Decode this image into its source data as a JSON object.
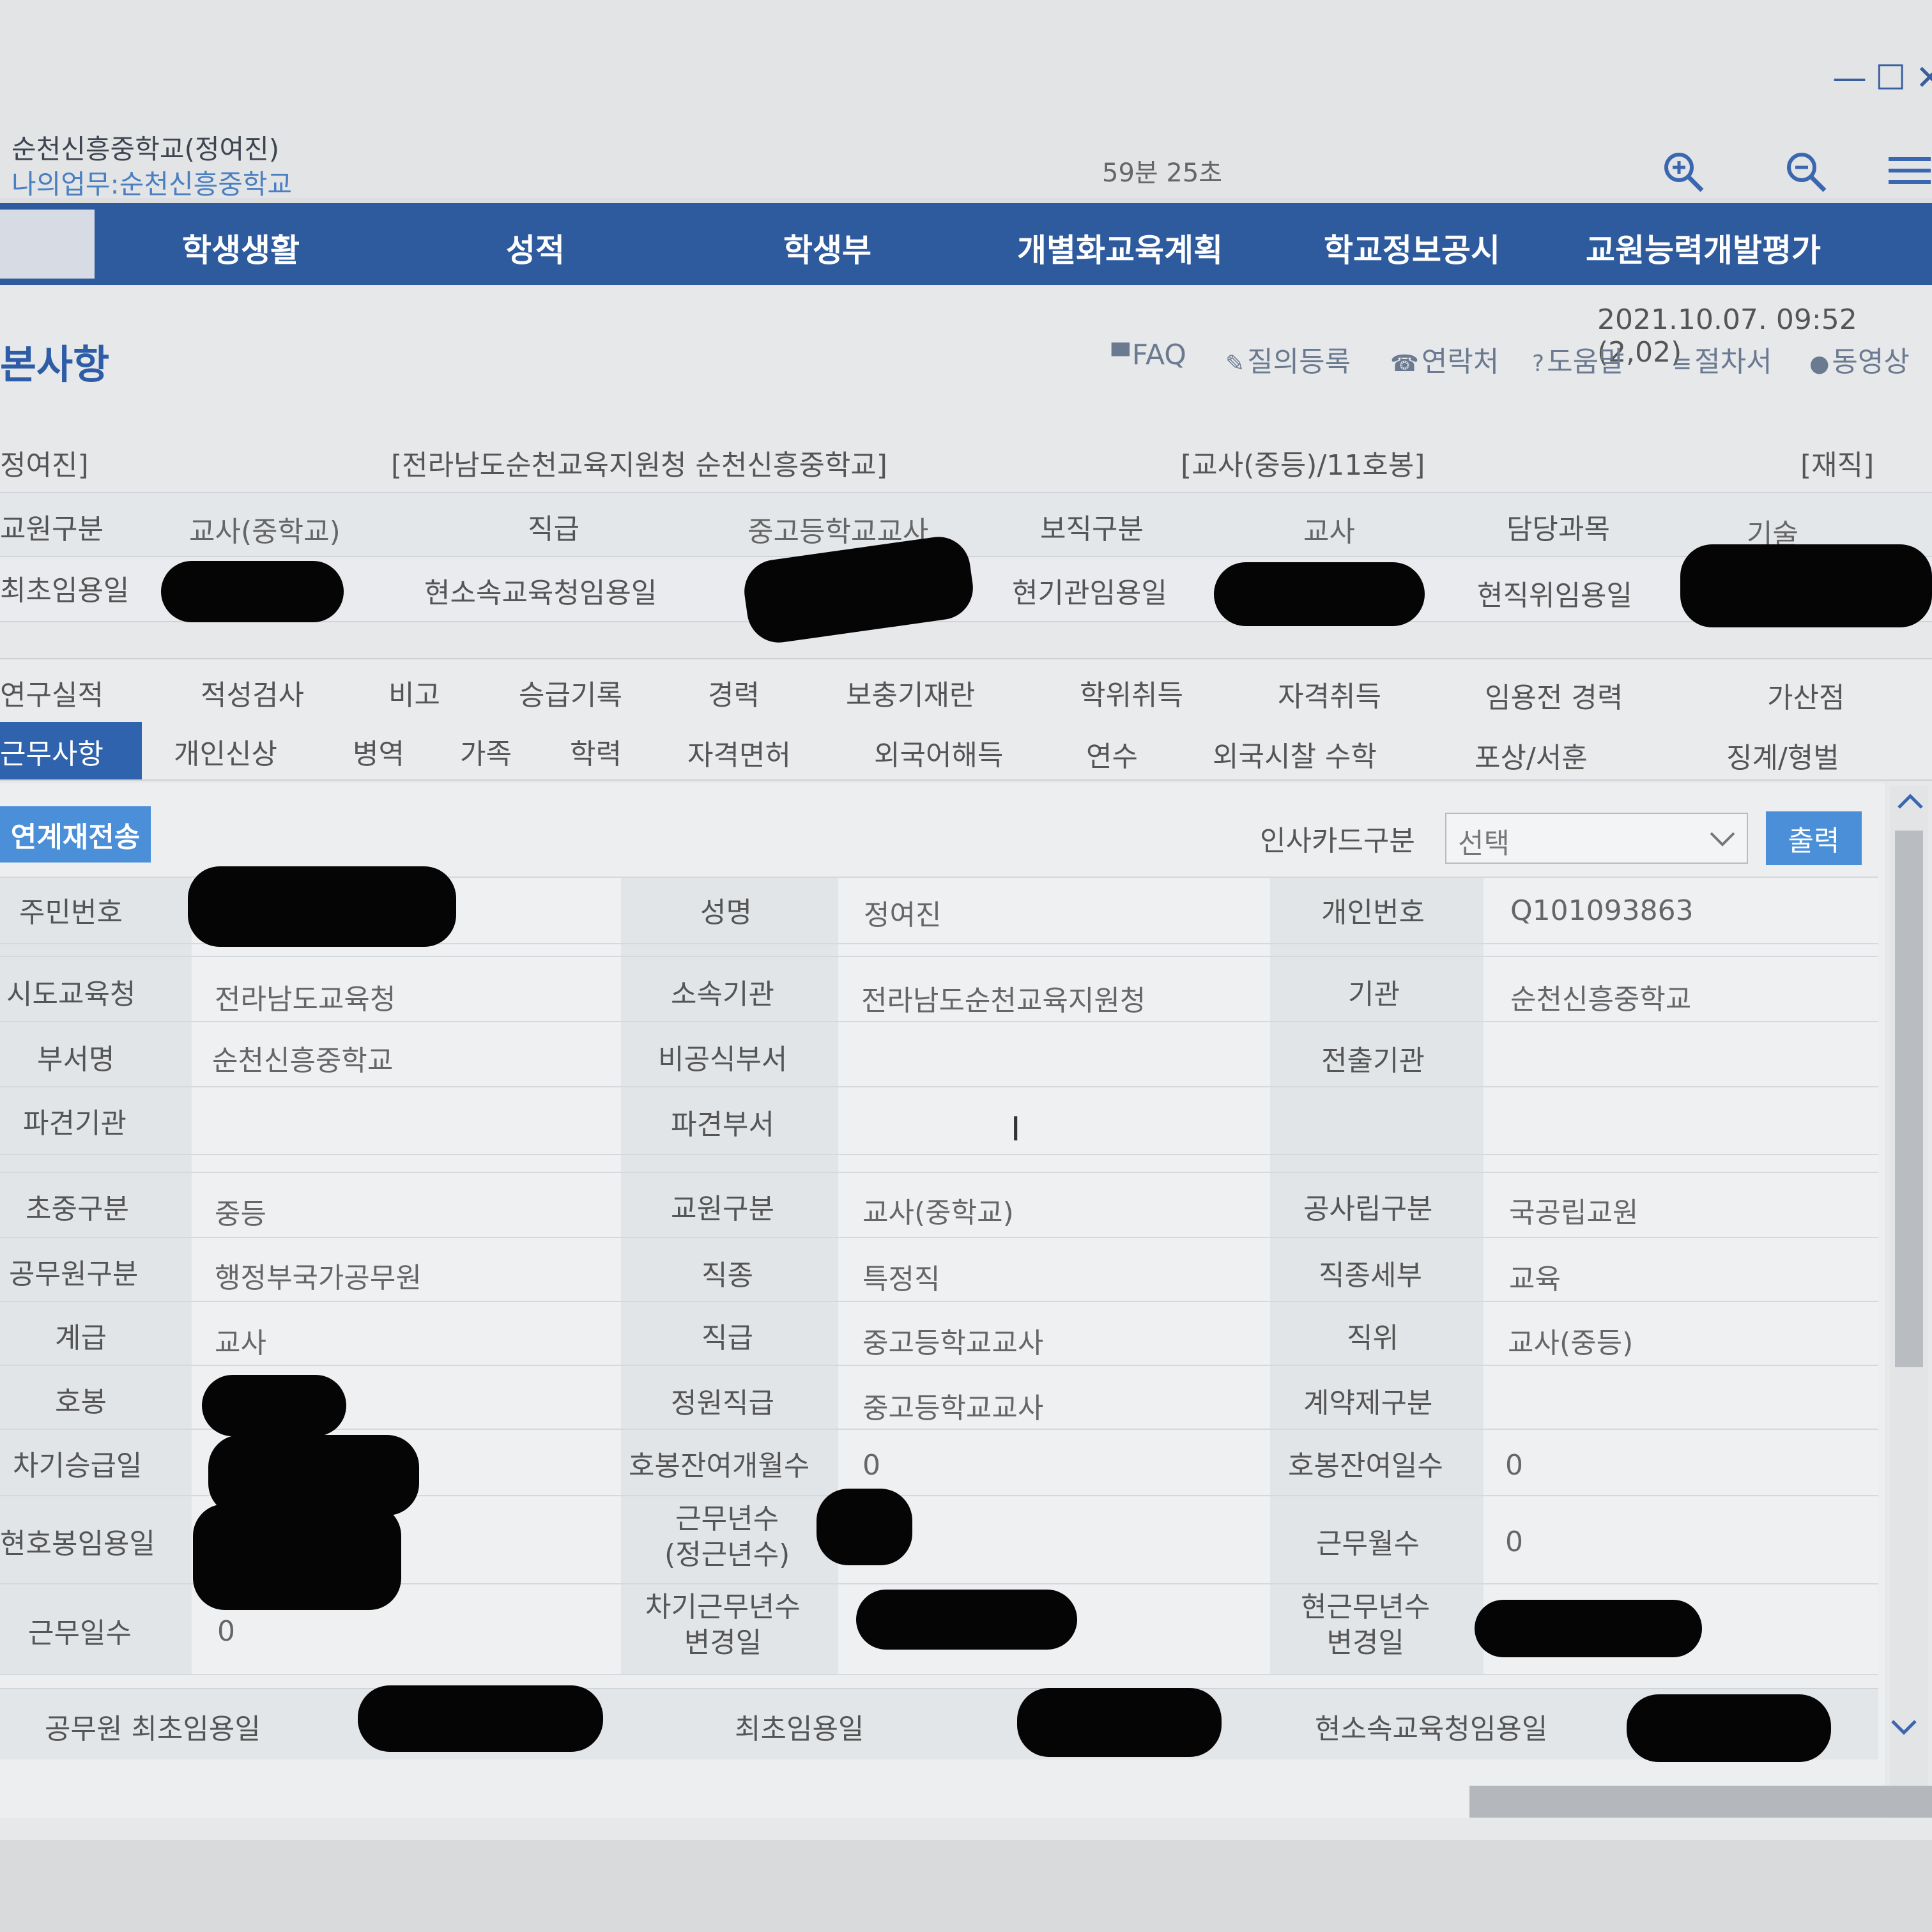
{
  "header": {
    "school_user": "순천신흥중학교(정여진)",
    "my_work": "나의업무:순천신흥중학교",
    "session_timer": "59분 25초"
  },
  "nav": {
    "items": [
      "학생생활",
      "성적",
      "학생부",
      "개별화교육계획",
      "학교정보공시",
      "교원능력개발평가"
    ]
  },
  "page": {
    "title": "본사항",
    "datetime": "2021.10.07. 09:52 (2,02)",
    "util_links": [
      {
        "icon": "chat-icon",
        "glyph": "▀",
        "label": "FAQ"
      },
      {
        "icon": "pencil-icon",
        "glyph": "✎",
        "label": "질의등록"
      },
      {
        "icon": "phone-icon",
        "glyph": "☎",
        "label": "연락처"
      },
      {
        "icon": "help-icon",
        "glyph": "?",
        "label": "도움말"
      },
      {
        "icon": "doc-icon",
        "glyph": "≡",
        "label": "절차서"
      },
      {
        "icon": "play-icon",
        "glyph": "●",
        "label": "동영상"
      }
    ]
  },
  "info_bar": {
    "name": "정여진]",
    "org": "[전라남도순천교육지원청 순천신흥중학교]",
    "grade": "[교사(중등)/11호봉]",
    "status": "[재직]"
  },
  "summary": {
    "row1": [
      {
        "label": "교원구분",
        "value": "교사(중학교)"
      },
      {
        "label": "직급",
        "value": "중고등학교교사"
      },
      {
        "label": "보직구분",
        "value": "교사"
      },
      {
        "label": "담당과목",
        "value": "기술"
      }
    ],
    "row2": [
      "최초임용일",
      "현소속교육청임용일",
      "현기관임용일",
      "현직위임용일"
    ]
  },
  "tabs": {
    "row1": [
      "연구실적",
      "적성검사",
      "비고",
      "승급기록",
      "경력",
      "보충기재란",
      "학위취득",
      "자격취득",
      "임용전 경력",
      "가산점"
    ],
    "row2": [
      "근무사항",
      "개인신상",
      "병역",
      "가족",
      "학력",
      "자격면허",
      "외국어해득",
      "연수",
      "외국시찰 수학",
      "포상/서훈",
      "징계/형벌"
    ]
  },
  "toolbar": {
    "resend_label": "연계재전송",
    "card_type_label": "인사카드구분",
    "card_type_value": "선택",
    "print_label": "출력"
  },
  "detail": {
    "id_number_label": "주민번호",
    "name_label": "성명",
    "name_value": "정여진",
    "personal_no_label": "개인번호",
    "personal_no_value": "Q101093863",
    "edu_office_label": "시도교육청",
    "edu_office_value": "전라남도교육청",
    "parent_org_label": "소속기관",
    "parent_org_value": "전라남도순천교육지원청",
    "org_label": "기관",
    "org_value": "순천신흥중학교",
    "dept_label": "부서명",
    "dept_value": "순천신흥중학교",
    "informal_dept_label": "비공식부서",
    "transfer_org_label": "전출기관",
    "dispatch_org_label": "파견기관",
    "dispatch_dept_label": "파견부서",
    "school_level_label": "초중구분",
    "school_level_value": "중등",
    "teacher_type_label": "교원구분",
    "teacher_type_value": "교사(중학교)",
    "public_private_label": "공사립구분",
    "public_private_value": "국공립교원",
    "civil_type_label": "공무원구분",
    "civil_type_value": "행정부국가공무원",
    "job_kind_label": "직종",
    "job_kind_value": "특정직",
    "job_detail_label": "직종세부",
    "job_detail_value": "교육",
    "class_label": "계급",
    "class_value": "교사",
    "rank_label": "직급",
    "rank_value": "중고등학교교사",
    "position_label": "직위",
    "position_value": "교사(중등)",
    "step_label": "호봉",
    "quota_rank_label": "정원직급",
    "quota_rank_value": "중고등학교교사",
    "contract_label": "계약제구분",
    "next_promo_label": "차기승급일",
    "remain_months_label": "호봉잔여개월수",
    "remain_months_value": "0",
    "remain_days_label": "호봉잔여일수",
    "remain_days_value": "0",
    "cur_step_date_label": "현호봉임용일",
    "work_years_label": "근무년수\n(정근년수)",
    "work_months_label": "근무월수",
    "work_months_value": "0",
    "work_days_label": "근무일수",
    "work_days_value": "0",
    "next_years_change_label": "차기근무년수\n변경일",
    "cur_years_change_label": "현근무년수\n변경일",
    "civil_first_label": "공무원 최초임용일",
    "first_appoint_label": "최초임용일",
    "cur_office_appoint_label": "현소속교육청임용일"
  }
}
